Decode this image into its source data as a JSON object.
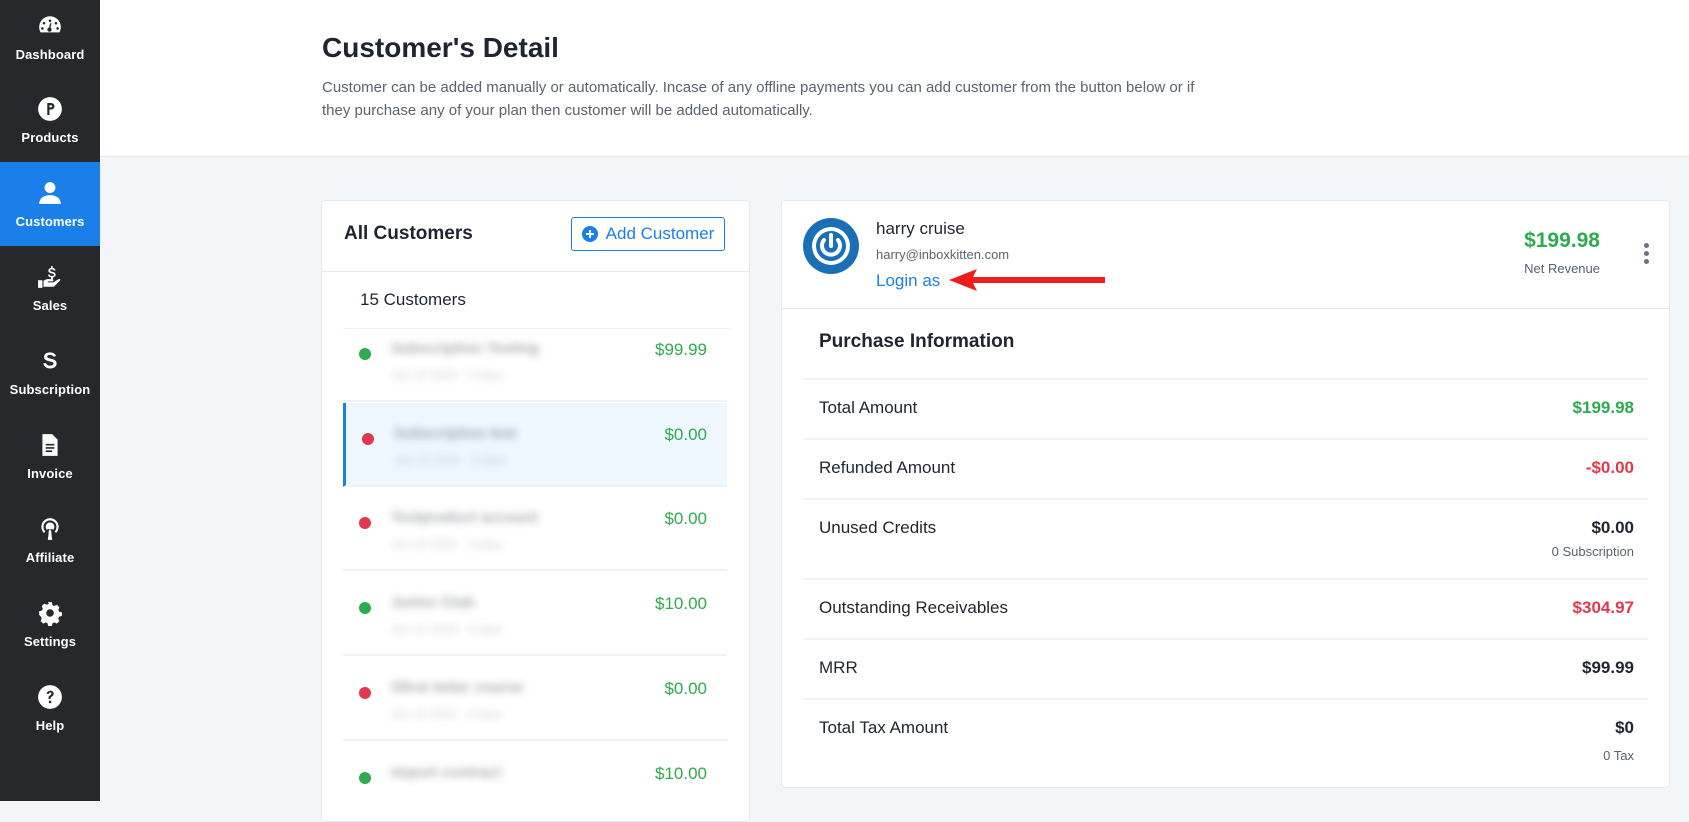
{
  "sidebar": {
    "items": [
      {
        "label": "Dashboard",
        "icon": "dashboard-icon",
        "active": false
      },
      {
        "label": "Products",
        "icon": "products-icon",
        "active": false
      },
      {
        "label": "Customers",
        "icon": "customers-icon",
        "active": true
      },
      {
        "label": "Sales",
        "icon": "sales-icon",
        "active": false
      },
      {
        "label": "Subscription",
        "icon": "subscription-icon",
        "active": false
      },
      {
        "label": "Invoice",
        "icon": "invoice-icon",
        "active": false
      },
      {
        "label": "Affiliate",
        "icon": "affiliate-icon",
        "active": false
      },
      {
        "label": "Settings",
        "icon": "settings-icon",
        "active": false
      },
      {
        "label": "Help",
        "icon": "help-icon",
        "active": false
      }
    ]
  },
  "header": {
    "title": "Customer's Detail",
    "description": "Customer can be added manually or automatically. Incase of any offline payments you can add customer from the button below or if they purchase any of your plan then customer will be added automatically."
  },
  "customer_list": {
    "title": "All Customers",
    "add_button_label": "Add Customer",
    "count_label": "15 Customers",
    "rows": [
      {
        "name": "Subscription Testing",
        "sub": "Jun 15 2023 · 2 days",
        "amount": "$99.99",
        "status": "active"
      },
      {
        "name": "Subscription test",
        "sub": "Jun 14 2023 · 3 days",
        "amount": "$0.00",
        "status": "inactive"
      },
      {
        "name": "Testproduct account",
        "sub": "Jun 13 2023 · 3 days",
        "amount": "$0.00",
        "status": "inactive"
      },
      {
        "name": "Junior Club",
        "sub": "Jun 12 2023 · 4 days",
        "amount": "$10.00",
        "status": "active"
      },
      {
        "name": "Sfirst letter course",
        "sub": "Jun 11 2023 · 4 days",
        "amount": "$0.00",
        "status": "inactive"
      },
      {
        "name": "Import contract",
        "sub": "Jun 10 2023 · 5 days",
        "amount": "$10.00",
        "status": "active"
      }
    ]
  },
  "customer_detail": {
    "name": "harry cruise",
    "email": "harry@inboxkitten.com",
    "login_as_label": "Login as",
    "net_revenue_value": "$199.98",
    "net_revenue_label": "Net Revenue",
    "section_title": "Purchase Information",
    "rows": [
      {
        "label": "Total Amount",
        "value": "$199.98",
        "color": "green",
        "note": ""
      },
      {
        "label": "Refunded Amount",
        "value": "-$0.00",
        "color": "red",
        "note": ""
      },
      {
        "label": "Unused Credits",
        "value": "$0.00",
        "color": "dark",
        "note": "0 Subscription"
      },
      {
        "label": "Outstanding Receivables",
        "value": "$304.97",
        "color": "red",
        "note": ""
      },
      {
        "label": "MRR",
        "value": "$99.99",
        "color": "dark",
        "note": ""
      },
      {
        "label": "Total Tax Amount",
        "value": "$0",
        "color": "dark",
        "note": "0 Tax"
      }
    ]
  },
  "colors": {
    "accent": "#1a7fe8",
    "sidebar": "#26282c",
    "green": "#2eaa4f",
    "red": "#e0394b"
  }
}
